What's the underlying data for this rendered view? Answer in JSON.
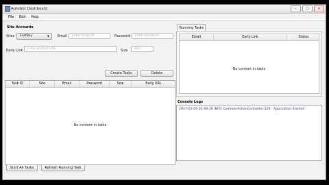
{
  "window": {
    "title": "Autobot Dashboard",
    "minimize": "–",
    "maximize": "□",
    "close": "✕"
  },
  "menu": [
    "File",
    "Edit",
    "Help"
  ],
  "site_accounts": {
    "title": "Site Accounts",
    "sites_label": "Sites",
    "sites_value": "EastBay",
    "email_label": "Email",
    "email_placeholder": "Enter Email ID",
    "password_label": "Password",
    "password_placeholder": "Enter password",
    "early_link_label": "Early Link",
    "early_link_placeholder": "Enter product URL",
    "size_label": "Size",
    "size_placeholder": "Size",
    "create_button": "Create Tasks",
    "delete_button": "Delete"
  },
  "tasks_table": {
    "columns": [
      "Task ID",
      "Site",
      "Email",
      "Password",
      "Size",
      "Early URL"
    ],
    "empty": "No content in table"
  },
  "running_tasks": {
    "tab": "Running Tasks",
    "columns": [
      "Email",
      "Early Link",
      "Status"
    ],
    "empty": "No content in table"
  },
  "console": {
    "title": "Console Logs",
    "lines": [
      "2017-02-09 22:49:20 INFO  CommonActionController:329 - Application Started"
    ]
  },
  "bottom": {
    "start_all": "Start All Tasks",
    "refresh": "Refresh Running Task"
  }
}
